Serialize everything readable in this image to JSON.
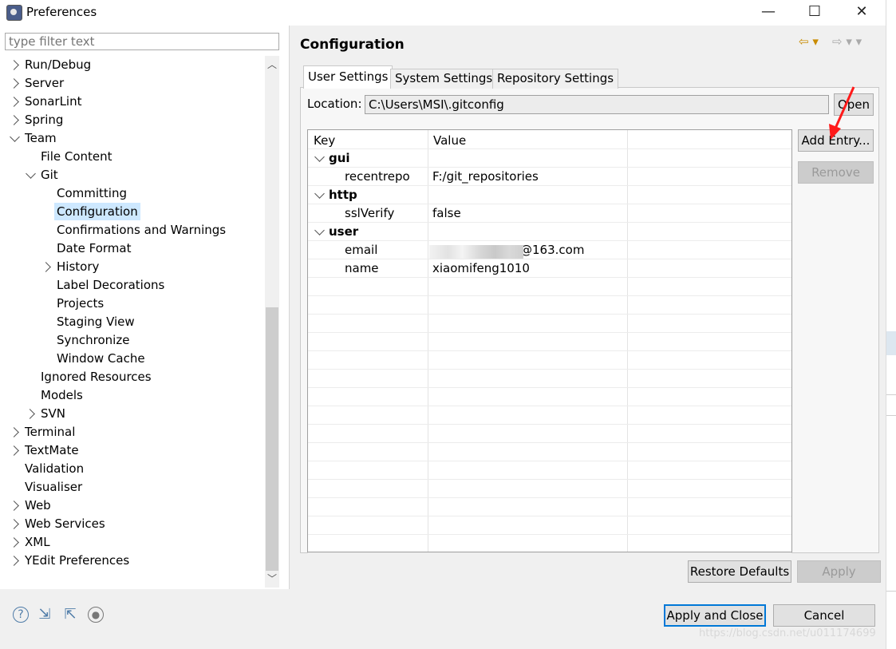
{
  "window": {
    "title": "Preferences",
    "minimize": "—",
    "maximize": "☐",
    "close": "✕"
  },
  "filter": {
    "placeholder": "type filter text"
  },
  "tree": [
    {
      "label": "Run/Debug",
      "indent": 0,
      "expander": "right"
    },
    {
      "label": "Server",
      "indent": 0,
      "expander": "right"
    },
    {
      "label": "SonarLint",
      "indent": 0,
      "expander": "right"
    },
    {
      "label": "Spring",
      "indent": 0,
      "expander": "right"
    },
    {
      "label": "Team",
      "indent": 0,
      "expander": "down"
    },
    {
      "label": "File Content",
      "indent": 1,
      "expander": "none"
    },
    {
      "label": "Git",
      "indent": 1,
      "expander": "down"
    },
    {
      "label": "Committing",
      "indent": 2,
      "expander": "none"
    },
    {
      "label": "Configuration",
      "indent": 2,
      "expander": "none",
      "selected": true
    },
    {
      "label": "Confirmations and Warnings",
      "indent": 2,
      "expander": "none"
    },
    {
      "label": "Date Format",
      "indent": 2,
      "expander": "none"
    },
    {
      "label": "History",
      "indent": 2,
      "expander": "right"
    },
    {
      "label": "Label Decorations",
      "indent": 2,
      "expander": "none"
    },
    {
      "label": "Projects",
      "indent": 2,
      "expander": "none"
    },
    {
      "label": "Staging View",
      "indent": 2,
      "expander": "none"
    },
    {
      "label": "Synchronize",
      "indent": 2,
      "expander": "none"
    },
    {
      "label": "Window Cache",
      "indent": 2,
      "expander": "none"
    },
    {
      "label": "Ignored Resources",
      "indent": 1,
      "expander": "none"
    },
    {
      "label": "Models",
      "indent": 1,
      "expander": "none"
    },
    {
      "label": "SVN",
      "indent": 1,
      "expander": "right"
    },
    {
      "label": "Terminal",
      "indent": 0,
      "expander": "right"
    },
    {
      "label": "TextMate",
      "indent": 0,
      "expander": "right"
    },
    {
      "label": "Validation",
      "indent": 0,
      "expander": "none"
    },
    {
      "label": "Visualiser",
      "indent": 0,
      "expander": "none"
    },
    {
      "label": "Web",
      "indent": 0,
      "expander": "right"
    },
    {
      "label": "Web Services",
      "indent": 0,
      "expander": "right"
    },
    {
      "label": "XML",
      "indent": 0,
      "expander": "right"
    },
    {
      "label": "YEdit Preferences",
      "indent": 0,
      "expander": "right"
    }
  ],
  "page": {
    "title": "Configuration",
    "nav_back": "⇦ ▾",
    "nav_forward": "⇨ ▾ ▾"
  },
  "tabs": [
    {
      "label": "User Settings",
      "active": true
    },
    {
      "label": "System Settings",
      "active": false
    },
    {
      "label": "Repository Settings",
      "active": false
    }
  ],
  "location": {
    "label": "Location:",
    "value": "C:\\Users\\MSI\\.gitconfig",
    "open_button": "Open"
  },
  "table": {
    "headers": [
      "Key",
      "Value"
    ],
    "rows": [
      {
        "key": "gui",
        "value": "",
        "section": true
      },
      {
        "key": "recentrepo",
        "value": "F:/git_repositories",
        "section": false
      },
      {
        "key": "http",
        "value": "",
        "section": true
      },
      {
        "key": "sslVerify",
        "value": "false",
        "section": false
      },
      {
        "key": "user",
        "value": "",
        "section": true
      },
      {
        "key": "email",
        "value": "@163.com",
        "section": false,
        "redacted": true
      },
      {
        "key": "name",
        "value": "xiaomifeng1010",
        "section": false
      }
    ]
  },
  "side_buttons": {
    "add_entry": "Add Entry...",
    "remove": "Remove"
  },
  "page_buttons": {
    "restore_defaults": "Restore Defaults",
    "apply": "Apply"
  },
  "dialog_buttons": {
    "apply_and_close": "Apply and Close",
    "cancel": "Cancel"
  },
  "bottom_icons": [
    "help-icon",
    "import-icon",
    "export-icon",
    "record-icon"
  ],
  "watermark": "https://blog.csdn.net/u011174699",
  "colors": {
    "selection": "#cde8ff",
    "default_button_border": "#0078d7",
    "annotation_arrow": "#ff1a1a"
  }
}
